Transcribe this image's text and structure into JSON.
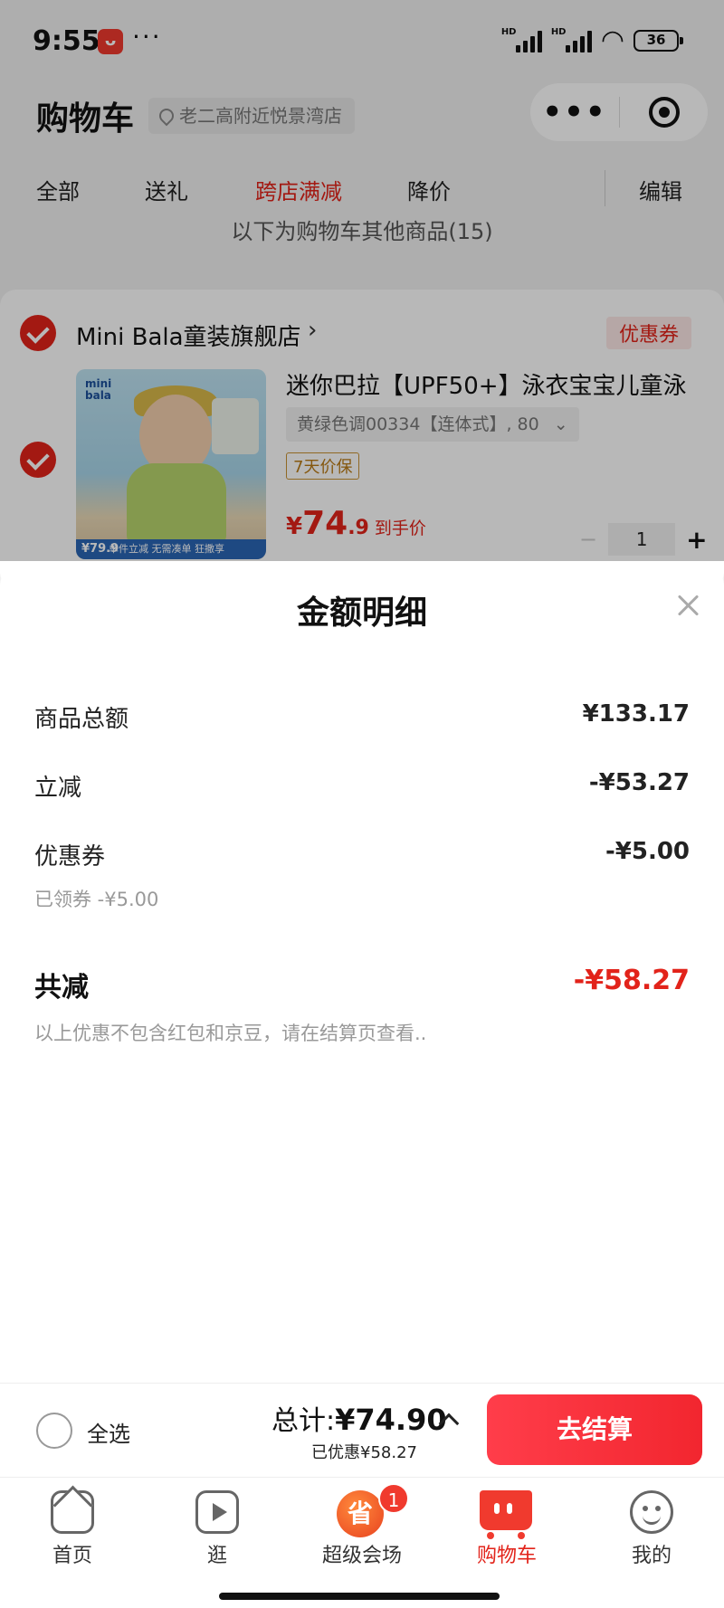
{
  "status_bar": {
    "time": "9:55",
    "app_icon": "jd-app-icon",
    "dots": "···",
    "hd1": "HD",
    "hd2": "HD",
    "battery": "36"
  },
  "header": {
    "title": "购物车",
    "location": "老二高附近悦景湾店",
    "capsule_more": "•••"
  },
  "tabs": [
    "全部",
    "送礼",
    "跨店满减",
    "降价"
  ],
  "tabs_edit": "编辑",
  "other_goods": "以下为购物车其他商品(15)",
  "shop": {
    "name": "Mini Bala童装旗舰店",
    "chevron": "›",
    "coupon_tag": "优惠券",
    "product": {
      "title": "迷你巴拉【UPF50+】泳衣宝宝儿童泳",
      "spec": "黄绿色调00334【连体式】, 80",
      "spec_arrow": "⌄",
      "guarantee": "7天价保",
      "price_currency": "¥",
      "price_int": "74",
      "price_dec": ".9",
      "price_label": "到手价",
      "qty": "1",
      "thumb_logo": "mini bala",
      "thumb_price": "¥79.9",
      "thumb_strip": "单件立减 无需凑单 狂撒享"
    }
  },
  "sheet": {
    "title": "金额明细",
    "rows": [
      {
        "label": "商品总额",
        "value": "¥133.17"
      },
      {
        "label": "立减",
        "value": "-¥53.27"
      },
      {
        "label": "优惠券",
        "value": "-¥5.00"
      }
    ],
    "coupon_sub": "已领券 -¥5.00",
    "total_label": "共减",
    "total_value": "-¥58.27",
    "note": "以上优惠不包含红包和京豆，请在结算页查看.."
  },
  "checkout": {
    "select_all": "全选",
    "total_prefix": "总计:",
    "total_value": "¥74.90",
    "saved": "已优惠¥58.27",
    "button": "去结算"
  },
  "tabbar": [
    {
      "label": "首页",
      "icon": "home-icon"
    },
    {
      "label": "逛",
      "icon": "play-icon"
    },
    {
      "label": "超级会场",
      "icon": "save-icon",
      "icon_text": "省",
      "badge": "1"
    },
    {
      "label": "购物车",
      "icon": "cart-icon",
      "active": true
    },
    {
      "label": "我的",
      "icon": "profile-icon"
    }
  ],
  "colors": {
    "accent": "#e2231a",
    "button": "#f2262f"
  }
}
